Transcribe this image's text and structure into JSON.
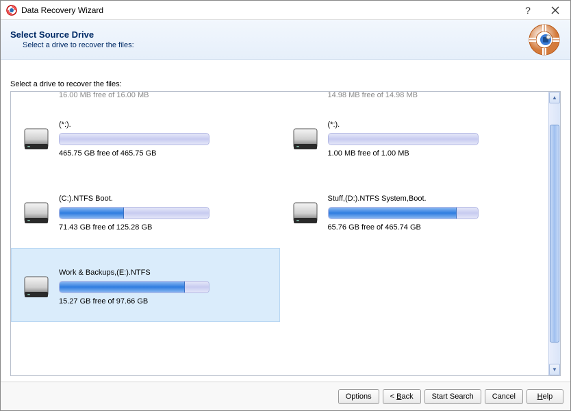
{
  "window": {
    "title": "Data Recovery Wizard"
  },
  "header": {
    "title": "Select Source Drive",
    "subtitle": "Select a drive to recover the files:"
  },
  "content_label": "Select a drive to recover the files:",
  "cutoff": {
    "left": "16.00 MB free of 16.00 MB",
    "right": "14.98 MB free of 14.98 MB"
  },
  "drives": [
    {
      "name": "(*:).",
      "free": "465.75 GB free of 465.75 GB",
      "fill_pct": 0,
      "selected": false
    },
    {
      "name": "(*:).",
      "free": "1.00 MB free of 1.00 MB",
      "fill_pct": 0,
      "selected": false
    },
    {
      "name": "(C:).NTFS Boot.",
      "free": "71.43 GB free of 125.28 GB",
      "fill_pct": 43,
      "selected": false
    },
    {
      "name": "Stuff,(D:).NTFS System,Boot.",
      "free": "65.76 GB free of 465.74 GB",
      "fill_pct": 86,
      "selected": false
    },
    {
      "name": "Work & Backups,(E:).NTFS",
      "free": "15.27 GB free of 97.66 GB",
      "fill_pct": 84,
      "selected": true
    }
  ],
  "footer": {
    "options": "Options",
    "back_prefix": "< ",
    "back_u": "B",
    "back_suffix": "ack",
    "start": "Start Search",
    "cancel": "Cancel",
    "help_u": "H",
    "help_suffix": "elp"
  }
}
